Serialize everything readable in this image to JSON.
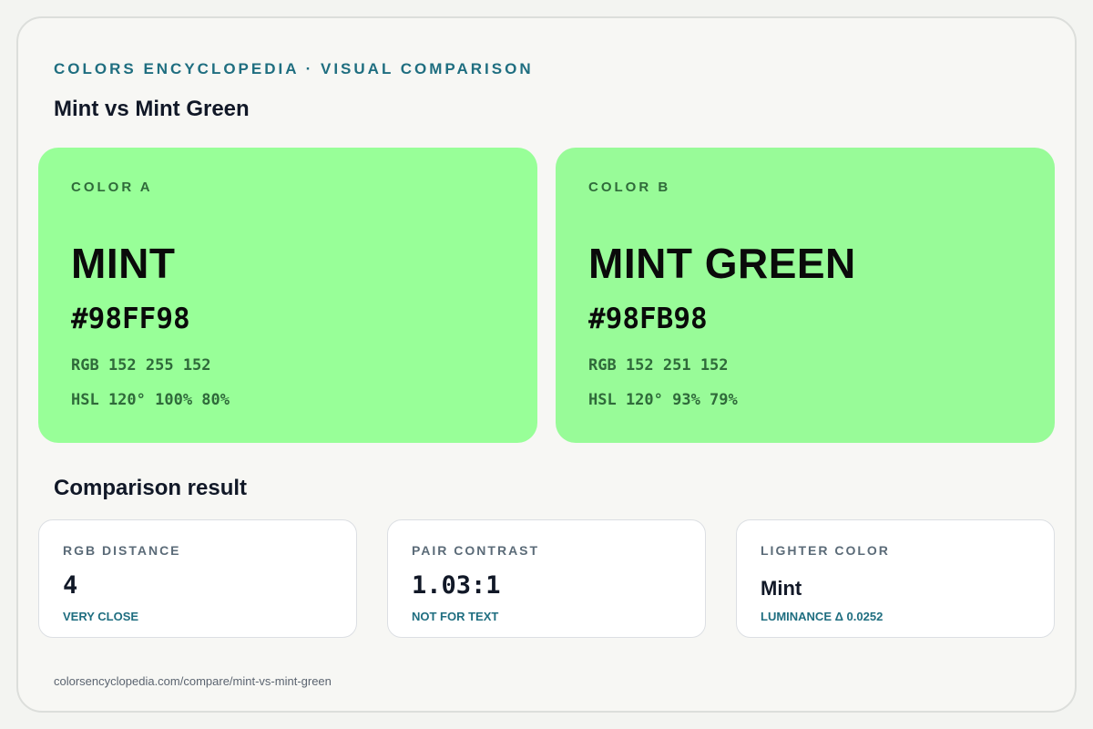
{
  "header": {
    "eyebrow": "COLORS ENCYCLOPEDIA · VISUAL COMPARISON",
    "title": "Mint vs Mint Green"
  },
  "colors": [
    {
      "label": "COLOR A",
      "name": "MINT",
      "hex": "#98FF98",
      "rgb": "RGB 152 255 152",
      "hsl": "HSL 120° 100% 80%",
      "swatch_color": "#98FF98"
    },
    {
      "label": "COLOR B",
      "name": "MINT GREEN",
      "hex": "#98FB98",
      "rgb": "RGB 152 251 152",
      "hsl": "HSL 120° 93% 79%",
      "swatch_color": "#98FB98"
    }
  ],
  "comparison": {
    "title": "Comparison result",
    "cards": [
      {
        "label": "RGB DISTANCE",
        "value": "4",
        "note": "VERY CLOSE"
      },
      {
        "label": "PAIR CONTRAST",
        "value": "1.03:1",
        "note": "NOT FOR TEXT"
      },
      {
        "label": "LIGHTER COLOR",
        "value": "Mint",
        "note": "LUMINANCE Δ 0.0252"
      }
    ]
  },
  "footer": {
    "url": "colorsencyclopedia.com/compare/mint-vs-mint-green"
  },
  "theme": {
    "accent": "#1f6e80",
    "swatch_label_color": "#2f6a3a"
  }
}
